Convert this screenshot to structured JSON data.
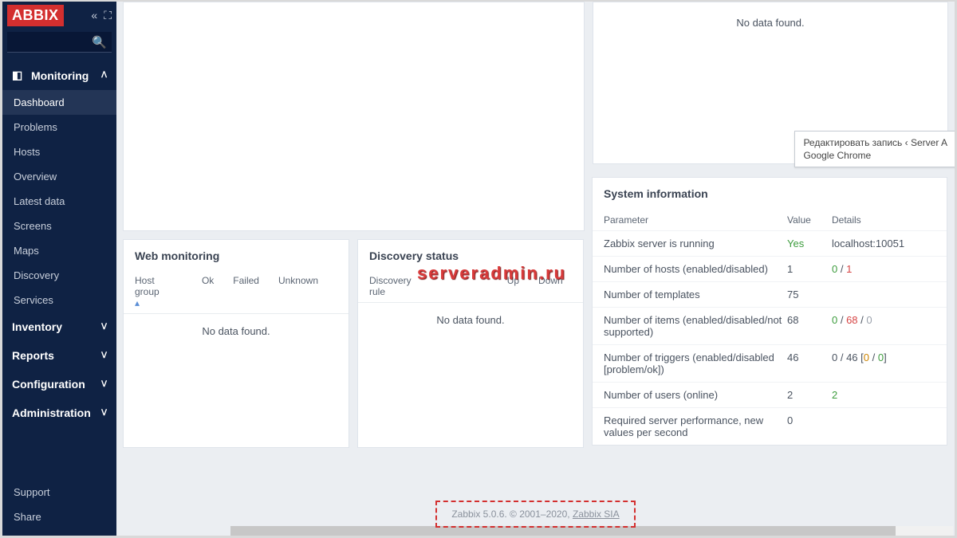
{
  "logo": "ABBIX",
  "sidebar": {
    "monitoring": {
      "label": "Monitoring",
      "items": [
        "Dashboard",
        "Problems",
        "Hosts",
        "Overview",
        "Latest data",
        "Screens",
        "Maps",
        "Discovery",
        "Services"
      ]
    },
    "inventory": "Inventory",
    "reports": "Reports",
    "configuration": "Configuration",
    "administration": "Administration",
    "support": "Support",
    "share": "Share"
  },
  "panels": {
    "no_data_top": "No data found.",
    "web_title": "Web monitoring",
    "web_cols": {
      "hostgroup": "Host group",
      "ok": "Ok",
      "failed": "Failed",
      "unknown": "Unknown"
    },
    "web_nodata": "No data found.",
    "disc_title": "Discovery status",
    "disc_cols": {
      "rule": "Discovery rule",
      "up": "Up",
      "down": "Down"
    },
    "disc_nodata": "No data found."
  },
  "sysinfo": {
    "title": "System information",
    "head": {
      "param": "Parameter",
      "value": "Value",
      "details": "Details"
    },
    "rows": [
      {
        "param": "Zabbix server is running",
        "value": "Yes",
        "value_class": "green",
        "details_html": "localhost:10051"
      },
      {
        "param": "Number of hosts (enabled/disabled)",
        "value": "1",
        "value_class": "",
        "details_html": "<span class='green'>0</span> / <span class='red'>1</span>"
      },
      {
        "param": "Number of templates",
        "value": "75",
        "value_class": "",
        "details_html": ""
      },
      {
        "param": "Number of items (enabled/disabled/not supported)",
        "value": "68",
        "value_class": "",
        "details_html": "<span class='green'>0</span> / <span class='red'>68</span> / <span class='grey'>0</span>"
      },
      {
        "param": "Number of triggers (enabled/disabled [problem/ok])",
        "value": "46",
        "value_class": "",
        "details_html": "0 / 46 [<span class='orange'>0</span> / <span class='green'>0</span>]"
      },
      {
        "param": "Number of users (online)",
        "value": "2",
        "value_class": "",
        "details_html": "<span class='green'>2</span>"
      },
      {
        "param": "Required server performance, new values per second",
        "value": "0",
        "value_class": "",
        "details_html": ""
      }
    ]
  },
  "footer": {
    "text": "Zabbix 5.0.6. © 2001–2020, ",
    "link": "Zabbix SIA"
  },
  "watermark": "serveradmin.ru",
  "tooltip": {
    "line1": "Редактировать запись ‹ Server A",
    "line2": "Google Chrome"
  }
}
